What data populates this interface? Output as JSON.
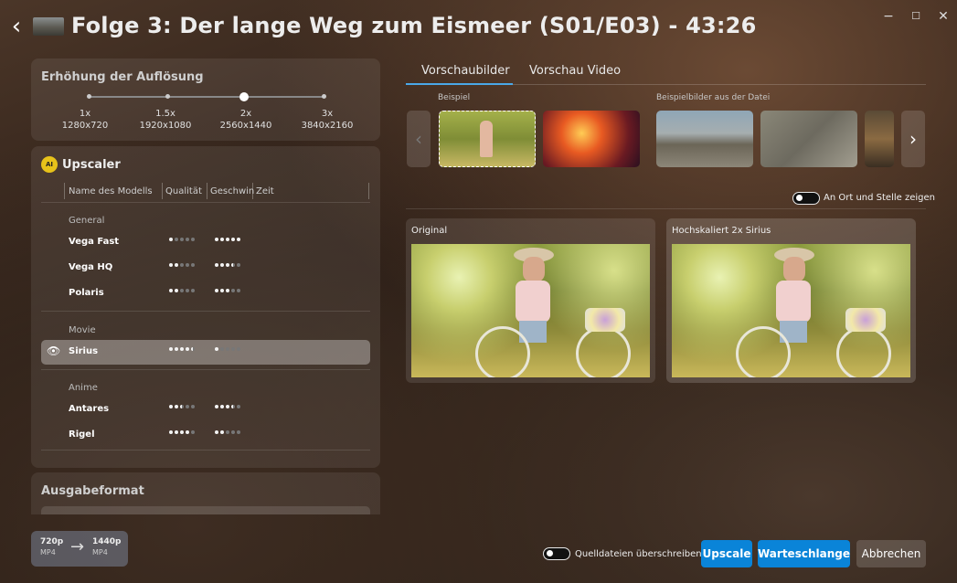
{
  "header": {
    "title": "Folge 3: Der lange Weg zum Eismeer (S01/E03) - 43:26"
  },
  "resolution": {
    "title": "Erhöhung der Auflösung",
    "options": [
      {
        "factor": "1x",
        "res": "1280x720"
      },
      {
        "factor": "1.5x",
        "res": "1920x1080"
      },
      {
        "factor": "2x",
        "res": "2560x1440"
      },
      {
        "factor": "3x",
        "res": "3840x2160"
      }
    ],
    "selected": "2x"
  },
  "upscaler": {
    "title": "Upscaler",
    "badge": "AI",
    "columns": {
      "name": "Name des Modells",
      "quality": "Qualität",
      "speed": "Geschwin",
      "time": "Zeit"
    },
    "groups": [
      {
        "label": "General",
        "models": [
          {
            "name": "Vega Fast",
            "quality": 1,
            "speed": 5
          },
          {
            "name": "Vega HQ",
            "quality": 2,
            "speed": 3.5
          },
          {
            "name": "Polaris",
            "quality": 2,
            "speed": 3
          }
        ]
      },
      {
        "label": "Movie",
        "models": [
          {
            "name": "Sirius",
            "quality": 4.5,
            "speed": 1,
            "selected": true
          }
        ]
      },
      {
        "label": "Anime",
        "models": [
          {
            "name": "Antares",
            "quality": 2.5,
            "speed": 3.5
          },
          {
            "name": "Rigel",
            "quality": 4,
            "speed": 2
          }
        ]
      }
    ]
  },
  "output": {
    "title": "Ausgabeformat"
  },
  "conversion": {
    "from_res": "720p",
    "from_fmt": "MP4",
    "to_res": "1440p",
    "to_fmt": "MP4"
  },
  "tabs": [
    {
      "label": "Vorschaubilder",
      "active": true
    },
    {
      "label": "Vorschau Video",
      "active": false
    }
  ],
  "preview": {
    "example_label": "Beispiel",
    "file_examples_label": "Beispielbilder aus der Datei",
    "show_in_place": "An Ort und Stelle zeigen",
    "original_label": "Original",
    "upscaled_label": "Hochskaliert 2x Sirius"
  },
  "footer": {
    "overwrite_label": "Quelldateien überschreiben",
    "upscale": "Upscale",
    "queue": "Warteschlange",
    "cancel": "Abbrechen"
  },
  "colors": {
    "accent": "#0a84d8",
    "selected_row": "#6b625c"
  }
}
